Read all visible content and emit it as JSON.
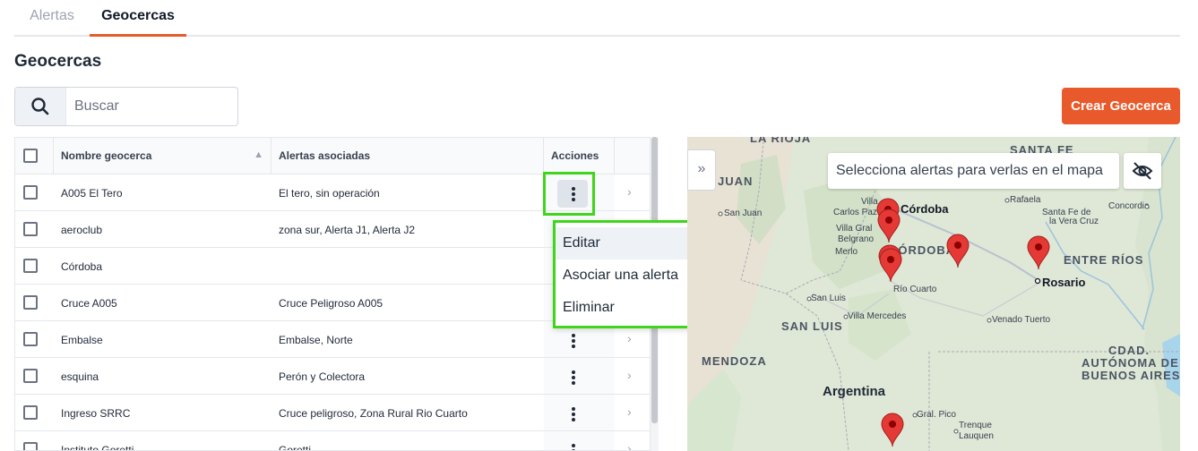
{
  "tabs": [
    {
      "label": "Alertas",
      "active": false
    },
    {
      "label": "Geocercas",
      "active": true
    }
  ],
  "page_title": "Geocercas",
  "search": {
    "placeholder": "Buscar",
    "value": ""
  },
  "create_button": "Crear Geocerca",
  "table": {
    "columns": {
      "name": "Nombre geocerca",
      "alerts": "Alertas asociadas",
      "actions": "Acciones"
    },
    "rows": [
      {
        "name": "A005 El Tero",
        "alerts": "El tero, sin operación"
      },
      {
        "name": "aeroclub",
        "alerts": "zona sur, Alerta J1, Alerta J2"
      },
      {
        "name": "Córdoba",
        "alerts": ""
      },
      {
        "name": "Cruce A005",
        "alerts": "Cruce Peligroso A005"
      },
      {
        "name": "Embalse",
        "alerts": "Embalse, Norte"
      },
      {
        "name": "esquina",
        "alerts": "Perón y Colectora"
      },
      {
        "name": "Ingreso SRRC",
        "alerts": "Cruce peligroso, Zona Rural Rio Cuarto"
      },
      {
        "name": "Instituto Goretti",
        "alerts": "Goretti"
      }
    ]
  },
  "actions_menu": {
    "items": [
      "Editar",
      "Asociar una alerta",
      "Eliminar"
    ],
    "open_for_row": 0
  },
  "map": {
    "select_placeholder": "Selecciona alertas para verlas en el mapa",
    "collapse_label": "»",
    "regions": [
      "LA RIOJA",
      "SANTA FE",
      "JUAN",
      "CÓRDOBA",
      "ENTRE RÍOS",
      "SAN LUIS",
      "MENDOZA",
      "CDAD.",
      "AUTÓNOMA DE",
      "BUENOS AIRES"
    ],
    "country": "Argentina",
    "big_cities": [
      "Córdoba",
      "Rosario"
    ],
    "cities": [
      "San Juan",
      "Villa",
      "Carlos Paz",
      "Villa Gral",
      "Belgrano",
      "Merlo",
      "Río Cuarto",
      "San Luis",
      "Villa Mercedes",
      "Venado Tuerto",
      "Rafaela",
      "Santa Fe de",
      "la Vera Cruz",
      "Concordia",
      "Gral. Pico",
      "Trenque",
      "Lauquen"
    ],
    "colors": {
      "marker": "#e53935",
      "marker_dot": "#8b0000"
    }
  },
  "colors": {
    "accent": "#e85a2b",
    "highlight": "#3fd61a"
  }
}
